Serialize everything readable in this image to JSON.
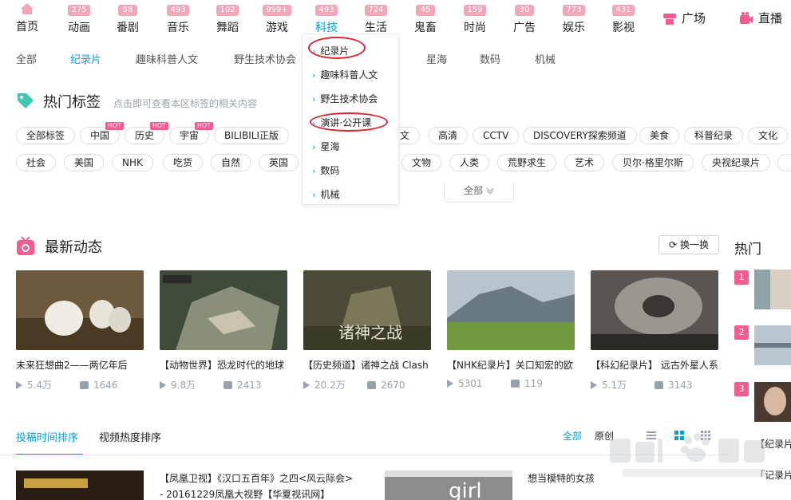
{
  "nav": {
    "items": [
      {
        "label": "首页",
        "badge": ""
      },
      {
        "label": "动画",
        "badge": "275"
      },
      {
        "label": "番剧",
        "badge": "58"
      },
      {
        "label": "音乐",
        "badge": "493"
      },
      {
        "label": "舞蹈",
        "badge": "102"
      },
      {
        "label": "游戏",
        "badge": "999+"
      },
      {
        "label": "科技",
        "badge": "493"
      },
      {
        "label": "生活",
        "badge": "724"
      },
      {
        "label": "鬼畜",
        "badge": "45"
      },
      {
        "label": "时尚",
        "badge": "159"
      },
      {
        "label": "广告",
        "badge": "30"
      },
      {
        "label": "娱乐",
        "badge": "773"
      },
      {
        "label": "影视",
        "badge": "431"
      }
    ],
    "plaza": "广场",
    "live": "直播"
  },
  "subnav": [
    "全部",
    "纪录片",
    "趣味科普人文",
    "野生技术协会",
    "星海",
    "数码",
    "机械"
  ],
  "dropdown": [
    "纪录片",
    "趣味科普人文",
    "野生技术协会",
    "演讲·公开课",
    "星海",
    "数码",
    "机械"
  ],
  "hot_tags": {
    "title": "热门标签",
    "desc": "点击即可查看本区标签的相关内容",
    "hot_label": "HOT",
    "row1": [
      "全部标签",
      "中国",
      "历史",
      "宇宙",
      "BILIBILI正版",
      "文",
      "高清",
      "CCTV",
      "DISCOVERY探索频道",
      "美食",
      "科普纪录",
      "文化"
    ],
    "row2": [
      "社会",
      "美国",
      "NHK",
      "吃货",
      "自然",
      "英国",
      "文物",
      "人类",
      "荒野求生",
      "艺术",
      "贝尔·格里尔斯",
      "央视纪录片"
    ],
    "all": "全部"
  },
  "latest": {
    "title": "最新动态",
    "refresh": "换一换",
    "hot_title": "热门",
    "cards": [
      {
        "title": "未来狂想曲2——两亿年后",
        "plays": "5.4万",
        "danmaku": "1646"
      },
      {
        "title": "【动物世界】恐龙时代的地球",
        "plays": "9.8万",
        "danmaku": "2413"
      },
      {
        "title": "【历史频道】诸神之战 Clash",
        "plays": "20.2万",
        "danmaku": "2670"
      },
      {
        "title": "【NHK纪录片】关口知宏的欧",
        "plays": "5301",
        "danmaku": "119"
      },
      {
        "title": "【科幻纪录片】 远古外星人系",
        "plays": "5.1万",
        "danmaku": "3143"
      }
    ],
    "thumb_text_3": "诸神之战",
    "ranks": [
      "1",
      "2",
      "3"
    ]
  },
  "bottom": {
    "sort_time": "投稿时间排序",
    "sort_hot": "视频热度排序",
    "view_all": "全部",
    "view_original": "原创",
    "item1_title": "【凤凰卫视】《汉口五百年》之四<风云际会> - 20161229凤凰大视野【华夏视讯网】",
    "item2_title": "想当模特的女孩",
    "right1": "【纪录片",
    "right2": "「记录片"
  },
  "colors": {
    "accent": "#00a1d6",
    "pink": "#f25d8e",
    "badge": "#f2a6b8",
    "circle": "#d6262f"
  }
}
